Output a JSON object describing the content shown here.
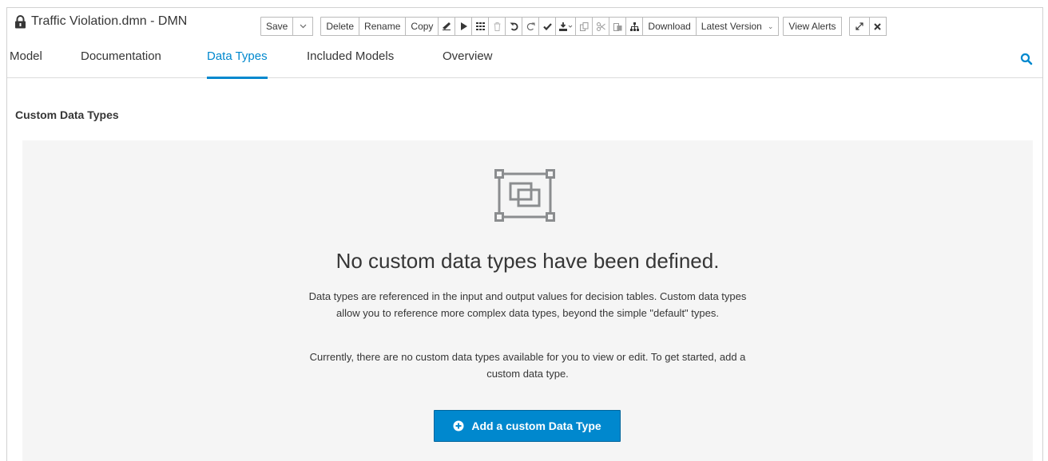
{
  "window": {
    "title": "Traffic Violation.dmn - DMN"
  },
  "toolbar": {
    "save_label": "Save",
    "delete_label": "Delete",
    "rename_label": "Rename",
    "copy_label": "Copy",
    "download_label": "Download",
    "version_label": "Latest Version",
    "alerts_label": "View Alerts",
    "icons": [
      "lock-icon",
      "caret-down-icon",
      "eraser-icon",
      "play-icon",
      "grid-icon",
      "trash-icon",
      "undo-icon",
      "redo-icon",
      "check-icon",
      "download-icon",
      "copy-icon",
      "cut-icon",
      "paste-icon",
      "sitemap-icon",
      "expand-icon",
      "close-icon"
    ]
  },
  "tabs": [
    {
      "label": "Model"
    },
    {
      "label": "Documentation"
    },
    {
      "label": "Data Types",
      "active": true
    },
    {
      "label": "Included Models"
    },
    {
      "label": "Overview"
    }
  ],
  "section": {
    "title": "Custom Data Types"
  },
  "empty_state": {
    "icon": "data-types-icon",
    "title": "No custom data types have been defined.",
    "description_line1": "Data types are referenced in the input and output values for decision tables. Custom data types",
    "description_line2": "allow you to reference more complex data types, beyond the simple \"default\" types.",
    "info_line1": "Currently, there are no custom data types available for you to view or edit. To get started, add a",
    "info_line2": "custom data type.",
    "button_label": "Add a custom Data Type"
  },
  "colors": {
    "accent": "#0088ce",
    "panel_background": "#f5f5f5",
    "text": "#363636",
    "icon_gray": "#8b8d8f"
  }
}
